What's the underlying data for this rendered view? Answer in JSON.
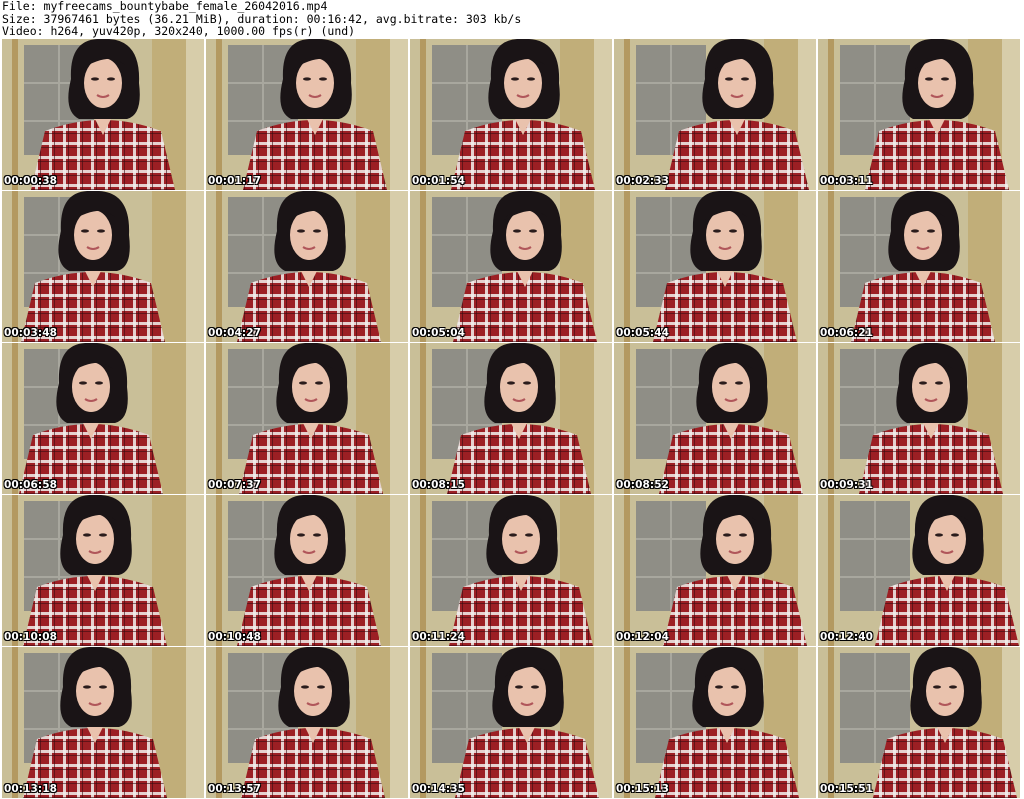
{
  "header": {
    "line1": "File: myfreecams_bountybabe_female_26042016.mp4",
    "line2": "Size: 37967461 bytes (36.21 MiB), duration: 00:16:42, avg.bitrate: 303 kb/s",
    "line3": "Video: h264, yuv420p, 320x240, 1000.00 fps(r) (und)"
  },
  "thumbnails": [
    "00:00:38",
    "00:01:17",
    "00:01:54",
    "00:02:33",
    "00:03:11",
    "00:03:48",
    "00:04:27",
    "00:05:04",
    "00:05:44",
    "00:06:21",
    "00:06:58",
    "00:07:37",
    "00:08:15",
    "00:08:52",
    "00:09:31",
    "00:10:08",
    "00:10:48",
    "00:11:24",
    "00:12:04",
    "00:12:40",
    "00:13:18",
    "00:13:57",
    "00:14:35",
    "00:15:13",
    "00:15:51"
  ],
  "colors": {
    "wall": "#c9bf98",
    "door": "#8f8e86",
    "frame": "#a07a35",
    "hair": "#1a1416",
    "skin": "#e9c2ad",
    "shirt": "#9c1f24",
    "plaid": "#f2f0ee"
  }
}
